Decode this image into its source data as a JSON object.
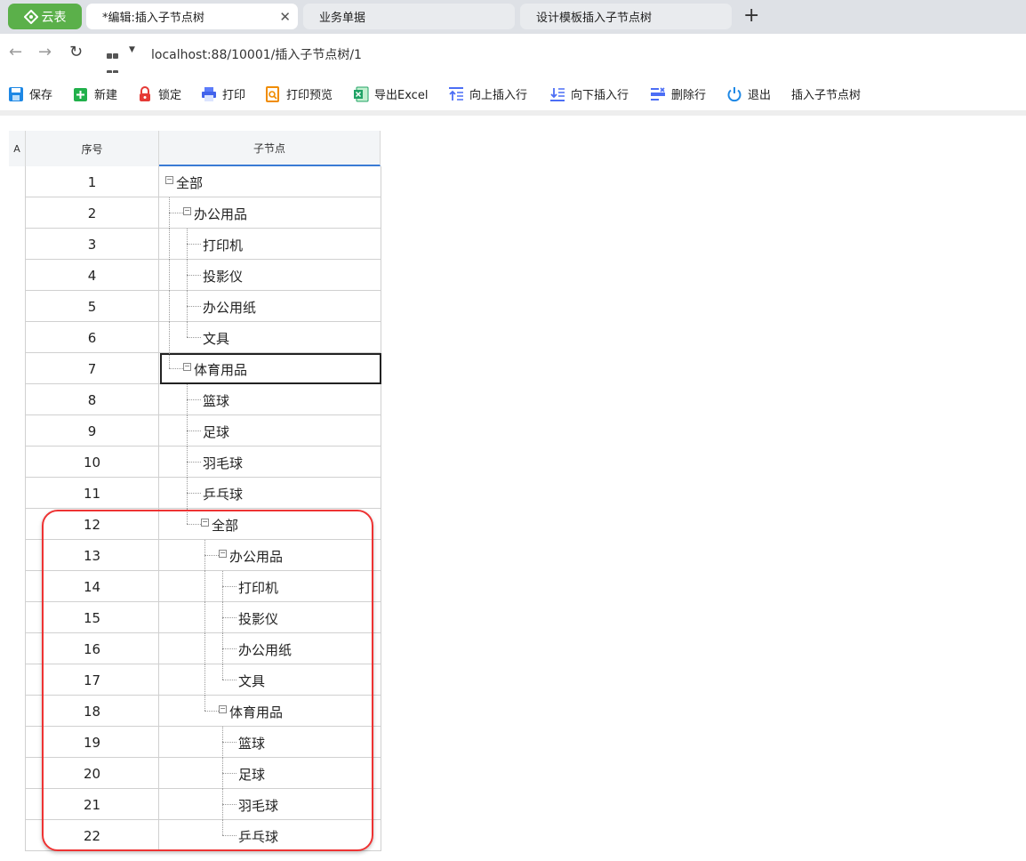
{
  "browser": {
    "brand_tab": "云表",
    "tabs": [
      {
        "label": "*编辑:插入子节点树"
      },
      {
        "label": "业务单据"
      },
      {
        "label": "设计模板插入子节点树"
      }
    ],
    "url": "localhost:88/10001/插入子节点树/1"
  },
  "toolbar": {
    "save": "保存",
    "new": "新建",
    "lock": "锁定",
    "print": "打印",
    "print_preview": "打印预览",
    "export_excel": "导出Excel",
    "insert_above": "向上插入行",
    "insert_below": "向下插入行",
    "delete_row": "删除行",
    "exit": "退出",
    "insert_child_tree": "插入子节点树"
  },
  "sheet": {
    "corner": "A",
    "columns": [
      "序号",
      "子节点"
    ],
    "rows": [
      {
        "no": "1",
        "node": "全部",
        "level": 0,
        "toggle": true
      },
      {
        "no": "2",
        "node": "办公用品",
        "level": 1,
        "toggle": true
      },
      {
        "no": "3",
        "node": "打印机",
        "level": 2,
        "toggle": false
      },
      {
        "no": "4",
        "node": "投影仪",
        "level": 2,
        "toggle": false
      },
      {
        "no": "5",
        "node": "办公用纸",
        "level": 2,
        "toggle": false
      },
      {
        "no": "6",
        "node": "文具",
        "level": 2,
        "toggle": false
      },
      {
        "no": "7",
        "node": "体育用品",
        "level": 1,
        "toggle": true,
        "selected": true
      },
      {
        "no": "8",
        "node": "篮球",
        "level": 2,
        "toggle": false
      },
      {
        "no": "9",
        "node": "足球",
        "level": 2,
        "toggle": false
      },
      {
        "no": "10",
        "node": "羽毛球",
        "level": 2,
        "toggle": false
      },
      {
        "no": "11",
        "node": "乒乓球",
        "level": 2,
        "toggle": false
      },
      {
        "no": "12",
        "node": "全部",
        "level": 2,
        "toggle": true
      },
      {
        "no": "13",
        "node": "办公用品",
        "level": 3,
        "toggle": true
      },
      {
        "no": "14",
        "node": "打印机",
        "level": 4,
        "toggle": false
      },
      {
        "no": "15",
        "node": "投影仪",
        "level": 4,
        "toggle": false
      },
      {
        "no": "16",
        "node": "办公用纸",
        "level": 4,
        "toggle": false
      },
      {
        "no": "17",
        "node": "文具",
        "level": 4,
        "toggle": false
      },
      {
        "no": "18",
        "node": "体育用品",
        "level": 3,
        "toggle": true
      },
      {
        "no": "19",
        "node": "篮球",
        "level": 4,
        "toggle": false
      },
      {
        "no": "20",
        "node": "足球",
        "level": 4,
        "toggle": false
      },
      {
        "no": "21",
        "node": "羽毛球",
        "level": 4,
        "toggle": false
      },
      {
        "no": "22",
        "node": "乒乓球",
        "level": 4,
        "toggle": false
      }
    ]
  },
  "colors": {
    "brand": "#5bb04a",
    "highlight": "#e33333",
    "header_accent": "#3a7bd5"
  }
}
